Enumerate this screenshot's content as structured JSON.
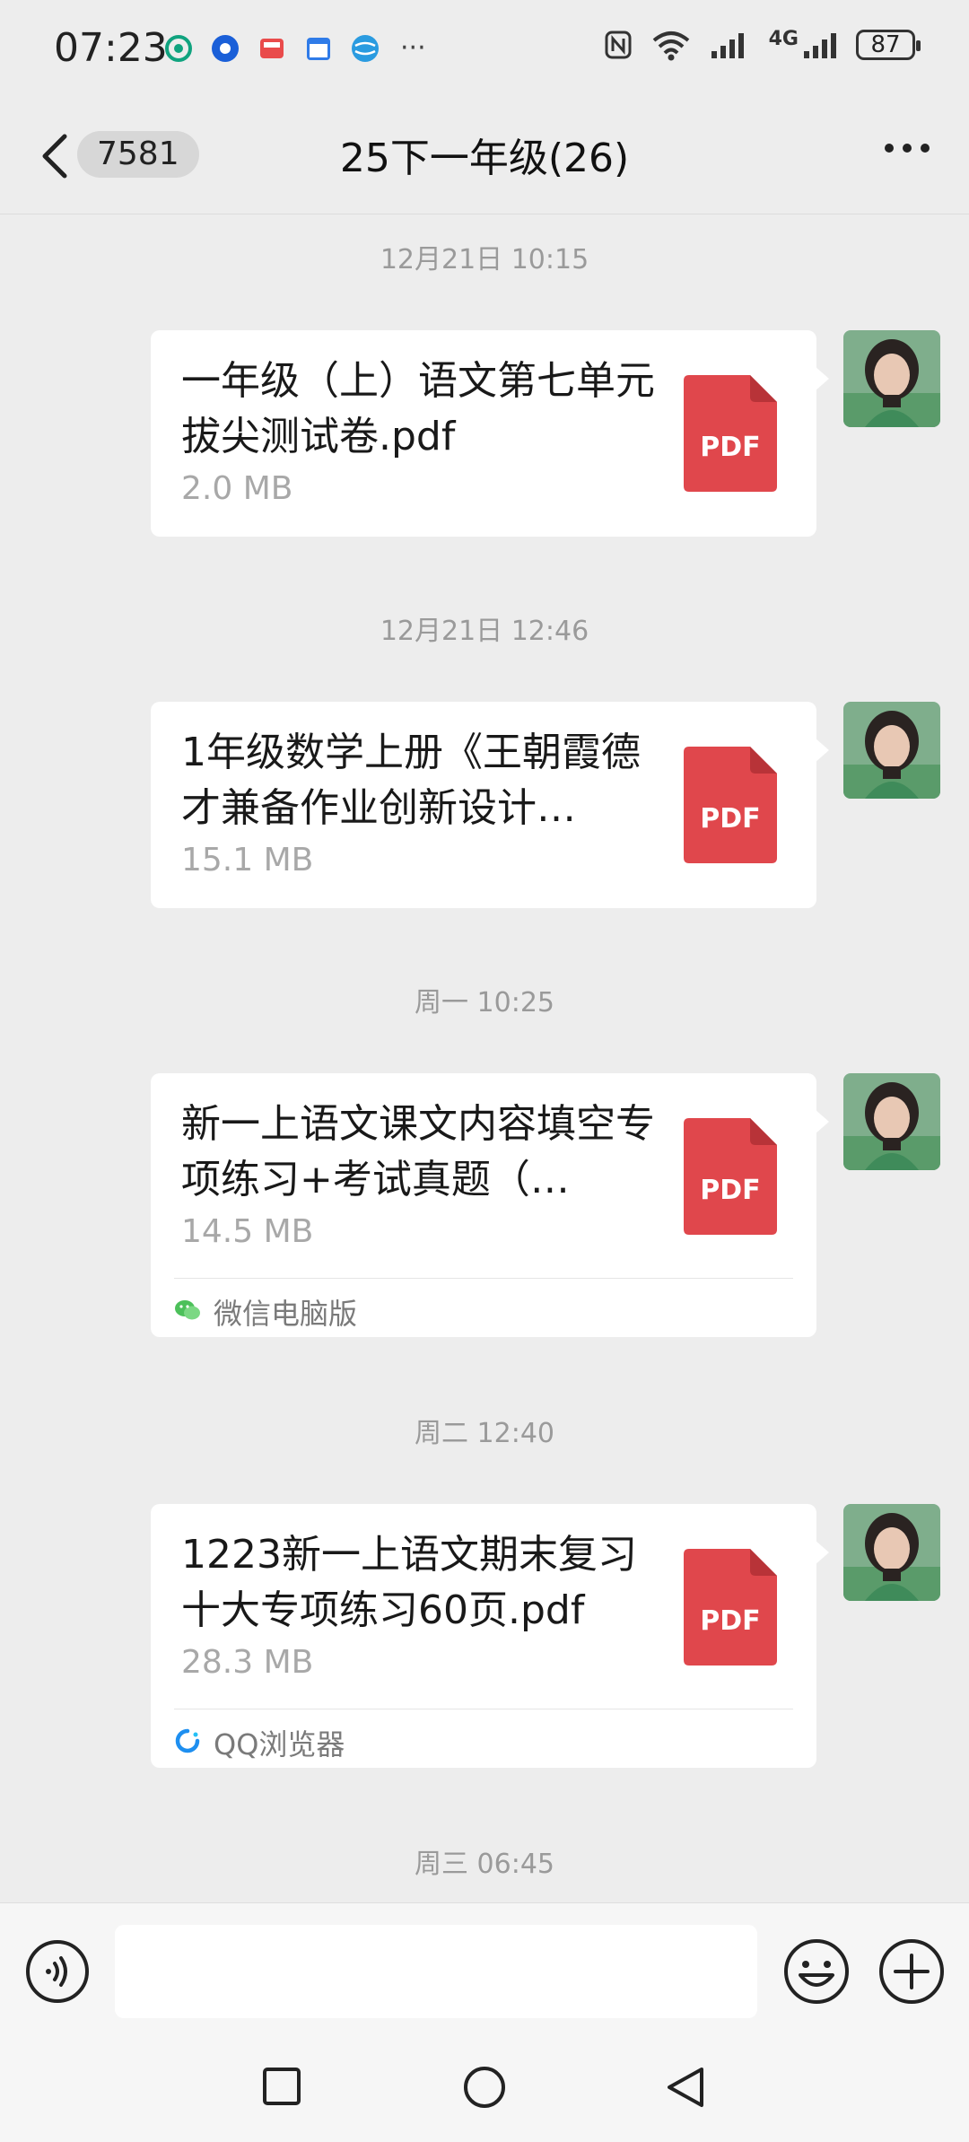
{
  "status_bar": {
    "time": "07:23",
    "app_icons": [
      "chatgpt-icon",
      "browser-dot-icon",
      "mail-icon",
      "calendar-icon",
      "globe-icon"
    ],
    "more": "···",
    "network": "4G",
    "battery": "87"
  },
  "header": {
    "unread_count": "7581",
    "title": "25下一年级(26)"
  },
  "messages": [
    {
      "timestamp": "12月21日 10:15",
      "file_title": "一年级（上）语文第七单元拔尖测试卷.pdf",
      "file_size": "2.0 MB",
      "file_type": "PDF",
      "source": null
    },
    {
      "timestamp": "12月21日 12:46",
      "file_title": "1年级数学上册《王朝霞德才兼备作业创新设计…",
      "file_size": "15.1 MB",
      "file_type": "PDF",
      "source": null
    },
    {
      "timestamp": "周一 10:25",
      "file_title": "新一上语文课文内容填空专项练习+考试真题（…",
      "file_size": "14.5 MB",
      "file_type": "PDF",
      "source": "微信电脑版"
    },
    {
      "timestamp": "周二 12:40",
      "file_title": "1223新一上语文期末复习十大专项练习60页.pdf",
      "file_size": "28.3 MB",
      "file_type": "PDF",
      "source": "QQ浏览器"
    }
  ],
  "last_timestamp": "周三 06:45",
  "colors": {
    "background": "#ededed",
    "pdf_red": "#e0474c",
    "bubble": "#ffffff"
  }
}
